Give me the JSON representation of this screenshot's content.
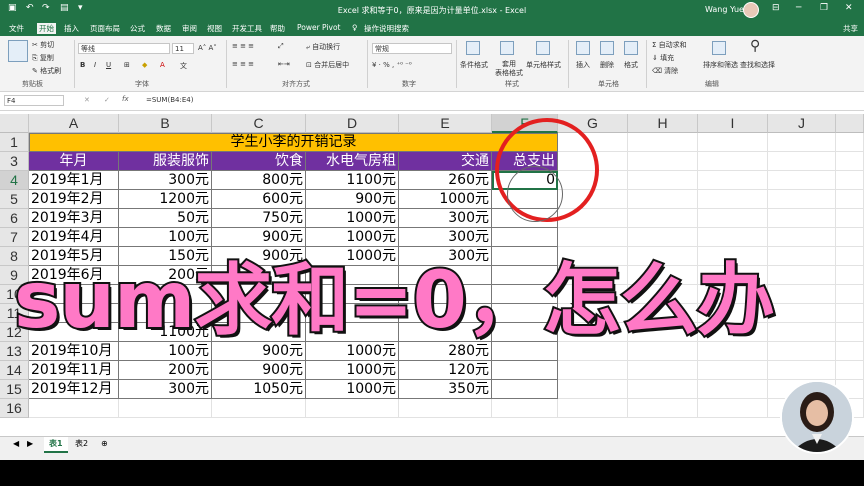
{
  "titlebar": {
    "title": "Excel 求和等于0，原来是因为计量单位.xlsx - Excel",
    "user": "Wang Yue"
  },
  "ribbon_tabs": [
    "文件",
    "开始",
    "插入",
    "页面布局",
    "公式",
    "数据",
    "审阅",
    "视图",
    "开发工具",
    "帮助",
    "Power Pivot",
    "操作说明搜索"
  ],
  "share_label": "共享",
  "ribbon": {
    "clipboard": {
      "cut": "剪切",
      "copy": "复制",
      "format_painter": "格式刷",
      "group": "剪贴板"
    },
    "font": {
      "name": "等线",
      "size": "11",
      "group": "字体"
    },
    "alignment": {
      "wrap": "自动换行",
      "merge": "合并后居中",
      "group": "对齐方式"
    },
    "number": {
      "format": "常规",
      "group": "数字"
    },
    "styles": {
      "cond": "条件格式",
      "table": "套用\n表格格式",
      "cell": "单元格样式",
      "group": "样式"
    },
    "cells": {
      "insert": "插入",
      "delete": "删除",
      "format": "格式",
      "group": "单元格"
    },
    "editing": {
      "autosum": "自动求和",
      "fill": "填充",
      "clear": "清除",
      "sort": "排序和筛选",
      "find": "查找和选择",
      "group": "编辑"
    }
  },
  "formula_bar": {
    "name_box": "F4",
    "formula": "=SUM(B4:E4)"
  },
  "columns": [
    "A",
    "B",
    "C",
    "D",
    "E",
    "F",
    "G",
    "H",
    "I",
    "J"
  ],
  "row_numbers": [
    "1",
    "3",
    "4",
    "5",
    "6",
    "7",
    "8",
    "9",
    "10",
    "11",
    "12",
    "13",
    "14",
    "15",
    "16"
  ],
  "sheet_title": "学生小李的开销记录",
  "headers": [
    "年月",
    "服装服饰",
    "饮食",
    "水电气房租",
    "交通",
    "总支出"
  ],
  "rows": [
    [
      "2019年1月",
      "300元",
      "800元",
      "1100元",
      "260元",
      "0"
    ],
    [
      "2019年2月",
      "1200元",
      "600元",
      "900元",
      "1000元",
      ""
    ],
    [
      "2019年3月",
      "50元",
      "750元",
      "1000元",
      "300元",
      ""
    ],
    [
      "2019年4月",
      "100元",
      "900元",
      "1000元",
      "300元",
      ""
    ],
    [
      "2019年5月",
      "150元",
      "900元",
      "1000元",
      "300元",
      ""
    ],
    [
      "2019年6月",
      "200元",
      "",
      "",
      "",
      ""
    ],
    [
      "",
      "",
      "",
      "",
      "",
      ""
    ],
    [
      "",
      "",
      "",
      "",
      "",
      ""
    ],
    [
      "",
      "1100元",
      "",
      "",
      "",
      ""
    ],
    [
      "2019年10月",
      "100元",
      "900元",
      "1000元",
      "280元",
      ""
    ],
    [
      "2019年11月",
      "200元",
      "900元",
      "1000元",
      "120元",
      ""
    ],
    [
      "2019年12月",
      "300元",
      "1050元",
      "1000元",
      "350元",
      ""
    ]
  ],
  "sheet_tabs": [
    "表1",
    "表2"
  ],
  "overlay_text": "sum求和=0，怎么办",
  "colors": {
    "excel_green": "#217346",
    "header_purple": "#7030a0",
    "title_gold": "#ffc000",
    "overlay_pink": "#ff79c6",
    "circle_red": "#e32020"
  }
}
